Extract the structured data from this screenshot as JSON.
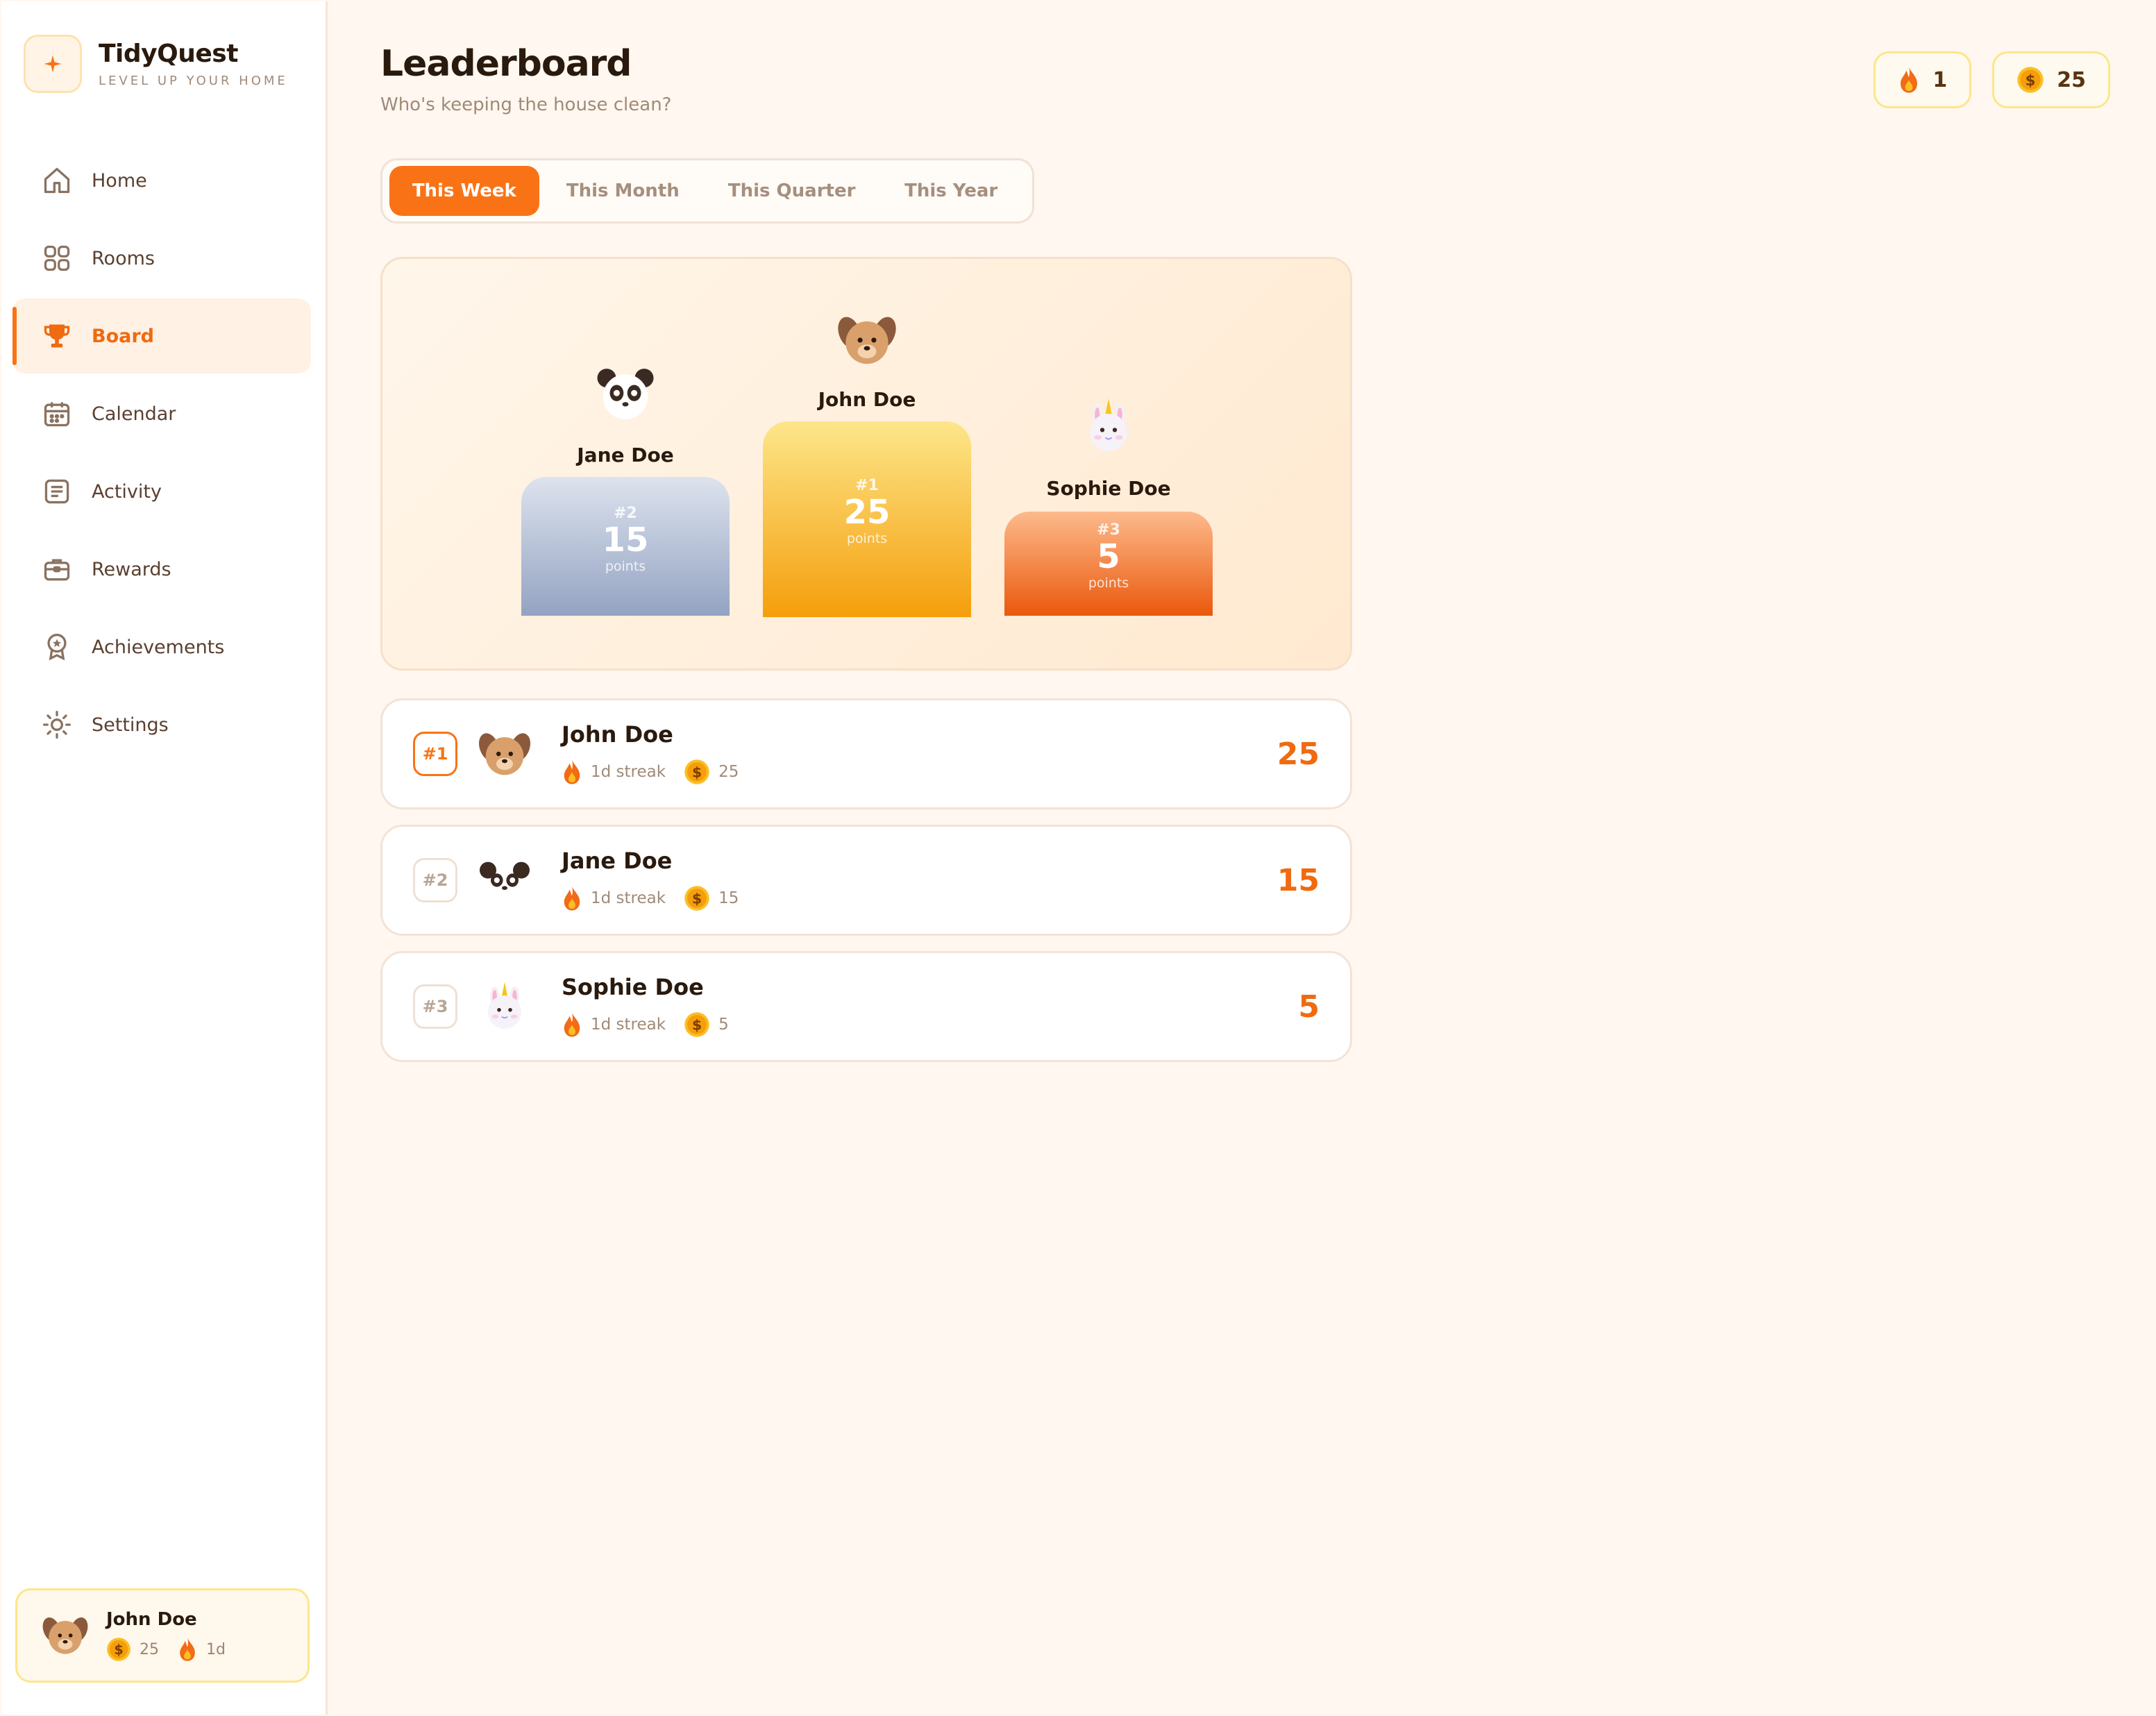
{
  "brand": {
    "name": "TidyQuest",
    "tagline": "LEVEL UP YOUR HOME"
  },
  "nav": [
    {
      "label": "Home",
      "icon": "home-icon"
    },
    {
      "label": "Rooms",
      "icon": "grid-icon"
    },
    {
      "label": "Board",
      "icon": "trophy-icon",
      "active": true
    },
    {
      "label": "Calendar",
      "icon": "calendar-icon"
    },
    {
      "label": "Activity",
      "icon": "list-icon"
    },
    {
      "label": "Rewards",
      "icon": "gift-box-icon"
    },
    {
      "label": "Achievements",
      "icon": "medal-icon"
    },
    {
      "label": "Settings",
      "icon": "gear-icon"
    }
  ],
  "current_user": {
    "name": "John Doe",
    "coins": "25",
    "streak": "1d"
  },
  "header": {
    "title": "Leaderboard",
    "subtitle": "Who's keeping the house clean?"
  },
  "top_badges": {
    "streak": "1",
    "coins": "25"
  },
  "tabs": [
    "This Week",
    "This Month",
    "This Quarter",
    "This Year"
  ],
  "active_tab": "This Week",
  "podium": {
    "first": {
      "name": "John Doe",
      "rank": "#1",
      "points": "25",
      "unit": "points"
    },
    "second": {
      "name": "Jane Doe",
      "rank": "#2",
      "points": "15",
      "unit": "points"
    },
    "third": {
      "name": "Sophie Doe",
      "rank": "#3",
      "points": "5",
      "unit": "points"
    }
  },
  "leaderboard": [
    {
      "rank": "#1",
      "name": "John Doe",
      "streak": "1d streak",
      "coins": "25",
      "points": "25",
      "avatar": "dog-avatar"
    },
    {
      "rank": "#2",
      "name": "Jane Doe",
      "streak": "1d streak",
      "coins": "15",
      "points": "15",
      "avatar": "panda-avatar"
    },
    {
      "rank": "#3",
      "name": "Sophie Doe",
      "streak": "1d streak",
      "coins": "5",
      "points": "5",
      "avatar": "unicorn-avatar"
    }
  ],
  "colors": {
    "accent": "#f97316",
    "gold_top": "#fde68a",
    "gold_bottom": "#f59e0b",
    "silver_top": "#dde3ee",
    "silver_bottom": "#94a3c2",
    "bronze_top": "#fdba8c",
    "bronze_bottom": "#ea580c"
  }
}
